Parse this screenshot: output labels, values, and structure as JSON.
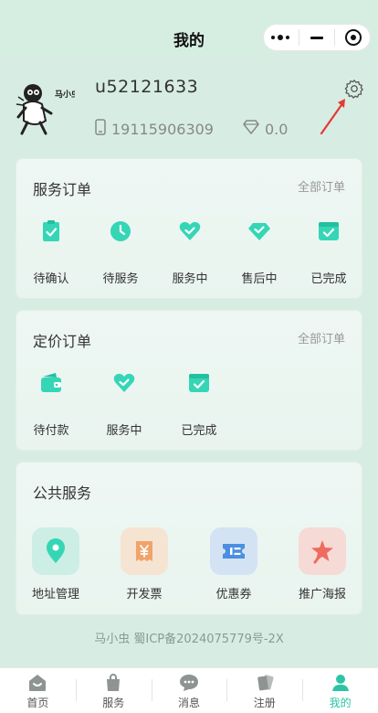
{
  "header": {
    "title": "我的"
  },
  "colors": {
    "accent": "#34d6b6",
    "accent_dark": "#22bfa0",
    "tab_active": "#2bc5a6",
    "arrow": "#e53935"
  },
  "profile": {
    "avatar_text": "马小虫",
    "username": "u52121633",
    "phone": "19115906309",
    "points": "0.0"
  },
  "service_orders": {
    "title": "服务订单",
    "more": "全部订单",
    "items": [
      {
        "label": "待确认",
        "icon": "clipboard-check-icon"
      },
      {
        "label": "待服务",
        "icon": "clock-icon"
      },
      {
        "label": "服务中",
        "icon": "heart-check-icon"
      },
      {
        "label": "售后中",
        "icon": "diamond-check-icon"
      },
      {
        "label": "已完成",
        "icon": "calendar-check-icon"
      }
    ]
  },
  "pricing_orders": {
    "title": "定价订单",
    "more": "全部订单",
    "items": [
      {
        "label": "待付款",
        "icon": "wallet-icon"
      },
      {
        "label": "服务中",
        "icon": "heart-check-icon"
      },
      {
        "label": "已完成",
        "icon": "calendar-check-icon"
      }
    ]
  },
  "public_services": {
    "title": "公共服务",
    "items": [
      {
        "label": "地址管理",
        "icon": "location-pin-icon",
        "bg": "#cdeee4"
      },
      {
        "label": "开发票",
        "icon": "invoice-icon",
        "bg": "#f6e4d2"
      },
      {
        "label": "优惠券",
        "icon": "coupon-icon",
        "bg": "#d3e3f3"
      },
      {
        "label": "推广海报",
        "icon": "star-poster-icon",
        "bg": "#f6dad6"
      }
    ]
  },
  "footer": {
    "icp": "马小虫 蜀ICP备2024075779号-2X"
  },
  "tabbar": [
    {
      "label": "首页",
      "icon": "home-icon",
      "active": false
    },
    {
      "label": "服务",
      "icon": "bag-icon",
      "active": false
    },
    {
      "label": "消息",
      "icon": "chat-icon",
      "active": false
    },
    {
      "label": "注册",
      "icon": "cards-icon",
      "active": false
    },
    {
      "label": "我的",
      "icon": "user-icon",
      "active": true
    }
  ]
}
